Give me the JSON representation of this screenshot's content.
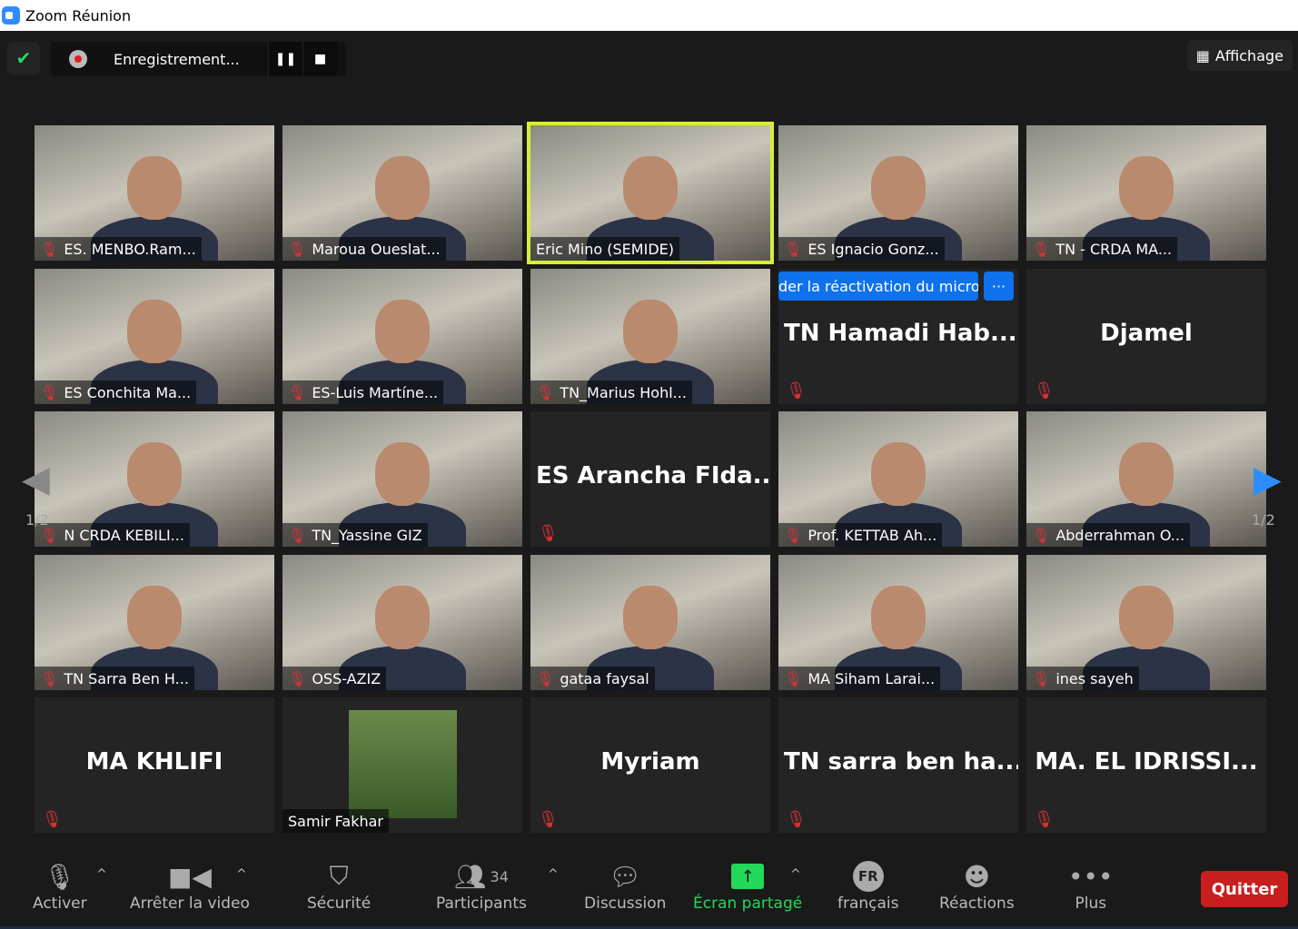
{
  "window": {
    "title": "Zoom Réunion"
  },
  "recording": {
    "label": "Enregistrement...",
    "pause_icon": "pause-icon",
    "stop_icon": "stop-icon"
  },
  "view": {
    "label": "Affichage"
  },
  "tiles": [
    {
      "name": "ES. MENBO.Ram...",
      "video": true
    },
    {
      "name": "Maroua Oueslat...",
      "video": true
    },
    {
      "name": "Eric Mino (SEMIDE)",
      "video": true,
      "active": true,
      "muted": false
    },
    {
      "name": "ES Ignacio Gonz...",
      "video": true
    },
    {
      "name": "TN - CRDA MA...",
      "video": true
    },
    {
      "name": "ES Conchita Ma...",
      "video": true
    },
    {
      "name": "ES-Luis Martíne...",
      "video": true
    },
    {
      "name": "TN_Marius Hohl...",
      "video": true
    },
    {
      "name": "TN  Hamadi  Hab...",
      "video": false
    },
    {
      "name": "Djamel",
      "video": false
    },
    {
      "name": "N CRDA KEBILI...",
      "video": true
    },
    {
      "name": "TN_Yassine GIZ",
      "video": true
    },
    {
      "name": "ES  Arancha  FIda...",
      "video": false
    },
    {
      "name": "Prof. KETTAB Ah...",
      "video": true
    },
    {
      "name": "Abderrahman O...",
      "video": true
    },
    {
      "name": "TN Sarra Ben H...",
      "video": true
    },
    {
      "name": "OSS-AZIZ",
      "video": true
    },
    {
      "name": "gataa faysal",
      "video": true
    },
    {
      "name": "MA Siham Larai...",
      "video": true
    },
    {
      "name": "ines sayeh",
      "video": true
    },
    {
      "name": "MA KHLIFI",
      "video": false
    },
    {
      "name": "Samir Fakhar",
      "video": true,
      "photo": true,
      "muted": false
    },
    {
      "name": "Myriam",
      "video": false
    },
    {
      "name": "TN  sarra  ben  ha...",
      "video": false
    },
    {
      "name": "MA.  EL  IDRISSI...",
      "video": false
    }
  ],
  "notification": {
    "text": "der la réactivation du micro",
    "more": "···"
  },
  "pagination": {
    "left": "1/2",
    "right": "1/2"
  },
  "toolbar": {
    "mute": "Activer",
    "video": "Arrêter la video",
    "security": "Sécurité",
    "participants": "Participants",
    "participants_count": "34",
    "chat": "Discussion",
    "share": "Écran partagé",
    "language": "français",
    "language_code": "FR",
    "reactions": "Réactions",
    "more": "Plus",
    "leave": "Quitter"
  },
  "colors": {
    "accent": "#0e72ed",
    "share": "#23d959",
    "leave": "#c81e1e",
    "active_speaker": "#d8ec3c",
    "muted": "#e0303a"
  }
}
